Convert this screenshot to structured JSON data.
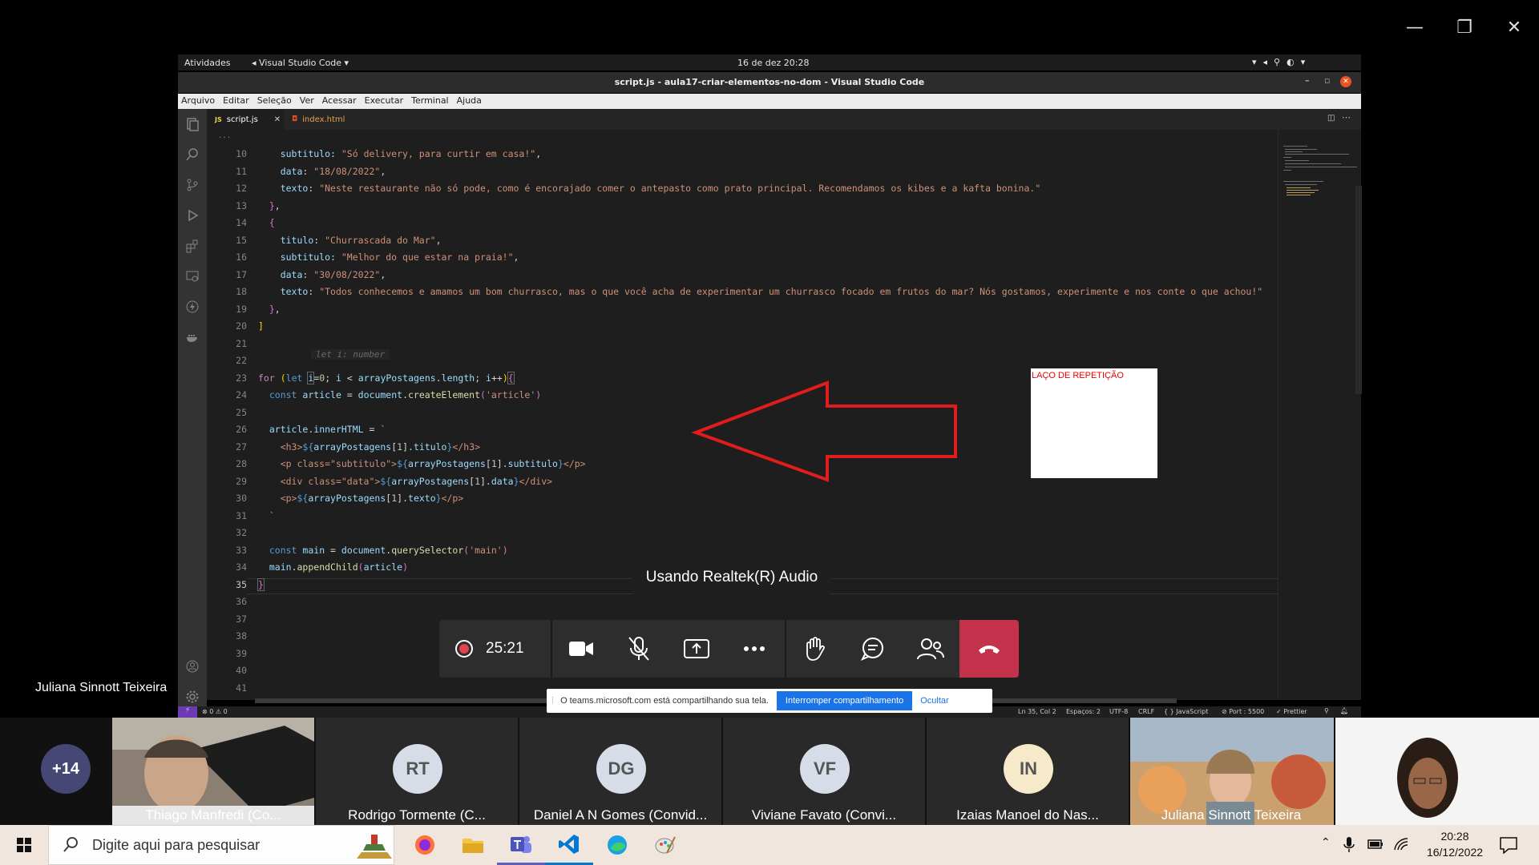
{
  "ubuntu_bar": {
    "activities": "Atividades",
    "app_menu": "Visual Studio Code",
    "clock": "16 de dez  20:28"
  },
  "vscode": {
    "title": "script.js - aula17-criar-elementos-no-dom - Visual Studio Code",
    "menu": [
      "Arquivo",
      "Editar",
      "Seleção",
      "Ver",
      "Acessar",
      "Executar",
      "Terminal",
      "Ajuda"
    ],
    "tabs": [
      {
        "label": "script.js",
        "active": true
      },
      {
        "label": "index.html",
        "active": false
      }
    ],
    "breadcrumb": "...",
    "hint": "let i: number",
    "line_numbers": [
      "10",
      "11",
      "12",
      "13",
      "14",
      "15",
      "16",
      "17",
      "18",
      "19",
      "20",
      "21",
      "22",
      "23",
      "24",
      "25",
      "26",
      "27",
      "28",
      "29",
      "30",
      "31",
      "32",
      "33",
      "34",
      "35",
      "36",
      "37",
      "38",
      "39",
      "40",
      "41"
    ],
    "status": {
      "errors": "⊗ 0 ⚠ 0",
      "position": "Ln 35, Col 2",
      "spaces": "Espaços: 2",
      "encoding": "UTF-8",
      "eol": "CRLF",
      "language": "{ } JavaScript",
      "port": "⊘ Port : 5500",
      "prettier": "✓ Prettier"
    }
  },
  "note": {
    "text": "LAÇO DE REPETIÇÃO"
  },
  "teams": {
    "audio_toast": "Usando Realtek(R) Audio",
    "timer": "25:21",
    "share_bar": {
      "message": "O teams.microsoft.com está compartilhando sua tela.",
      "stop_button": "Interromper compartilhamento",
      "hide_button": "Ocultar"
    },
    "presenter_name": "Juliana Sinnott Teixeira",
    "overflow_count": "+14",
    "participants": [
      {
        "name": "Thiago Manfredi (Co...",
        "initials": "",
        "avatar_color": "#d9d9d9",
        "video": true
      },
      {
        "name": "Rodrigo Tormente (C...",
        "initials": "RT",
        "avatar_color": "#d7dde8"
      },
      {
        "name": "Daniel A N Gomes (Convid...",
        "initials": "DG",
        "avatar_color": "#d7dde8"
      },
      {
        "name": "Viviane Favato (Convi...",
        "initials": "VF",
        "avatar_color": "#d7dde8"
      },
      {
        "name": "Izaias Manoel do Nas...",
        "initials": "IN",
        "avatar_color": "#f6eacb"
      },
      {
        "name": "Juliana Sinnott Teixeira",
        "initials": "",
        "avatar_color": "#b9a27a",
        "video": true
      }
    ]
  },
  "taskbar": {
    "search_placeholder": "Digite aqui para pesquisar",
    "time": "20:28",
    "date": "16/12/2022"
  }
}
